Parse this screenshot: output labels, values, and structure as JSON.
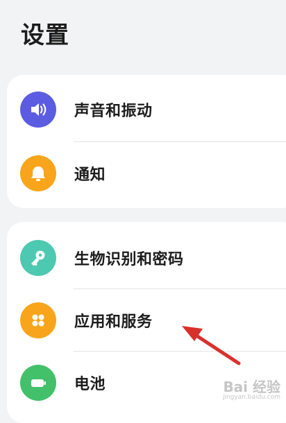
{
  "page": {
    "title": "设置"
  },
  "groups": [
    {
      "items": [
        {
          "label": "声音和振动",
          "icon": "volume-icon",
          "color": "#5b5ce2"
        },
        {
          "label": "通知",
          "icon": "bell-icon",
          "color": "#f8a51b"
        }
      ]
    },
    {
      "items": [
        {
          "label": "生物识别和密码",
          "icon": "key-icon",
          "color": "#4cc9b0"
        },
        {
          "label": "应用和服务",
          "icon": "apps-grid-icon",
          "color": "#f8a51b"
        },
        {
          "label": "电池",
          "icon": "battery-icon",
          "color": "#42c06a"
        }
      ]
    }
  ],
  "annotation": {
    "arrow_color": "#d9302b"
  },
  "watermark": {
    "main": "Bai 经验",
    "sub": "jingyan.baidu.com"
  }
}
